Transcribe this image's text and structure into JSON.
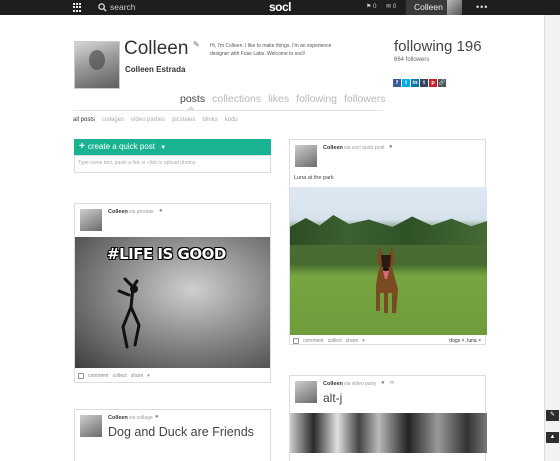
{
  "topbar": {
    "search_label": "search",
    "logo": "socl",
    "notifications_count": "0",
    "messages_count": "0",
    "user_name": "Colleen",
    "more_label": "•••"
  },
  "profile": {
    "display_name": "Colleen",
    "real_name": "Colleen Estrada",
    "bio": "Hi, I'm Colleen. I like to make things. I'm an experience designer with Fuse Labs. Welcome to socl!",
    "following": "following 196",
    "followers": "664 followers",
    "social_icons": [
      "facebook-icon",
      "twitter-icon",
      "linkedin-icon",
      "tumblr-icon",
      "pinterest-icon",
      "link-icon"
    ]
  },
  "tabs": [
    "posts",
    "collections",
    "likes",
    "following",
    "followers"
  ],
  "subtabs": [
    "all posts",
    "collages",
    "video parties",
    "picstales",
    "blinks",
    "kodu"
  ],
  "quick_post": {
    "button_label": "create a quick post",
    "placeholder": "Type some text, paste a link or click to upload photos."
  },
  "posts": [
    {
      "user": "Colleen",
      "via": "via picstale",
      "meme_text": "#LIFE IS GOOD",
      "actions": [
        "comment",
        "collect",
        "share"
      ]
    },
    {
      "user": "Colleen",
      "via": "via socl quick post",
      "text": "Luna at the park",
      "actions": [
        "comment",
        "collect",
        "share"
      ],
      "tags": "dogs ×, luna ×"
    },
    {
      "user": "Colleen",
      "via": "via collage",
      "title": "Dog and Duck are Friends"
    },
    {
      "user": "Colleen",
      "via": "via video party",
      "title": "alt-j"
    }
  ],
  "colors": {
    "accent": "#1ab391",
    "topbar": "#1e1e1e",
    "facebook": "#3b5998",
    "twitter": "#00aced",
    "linkedin": "#0e76a8",
    "tumblr": "#35465c",
    "pinterest": "#cb2027",
    "link": "#555555"
  }
}
